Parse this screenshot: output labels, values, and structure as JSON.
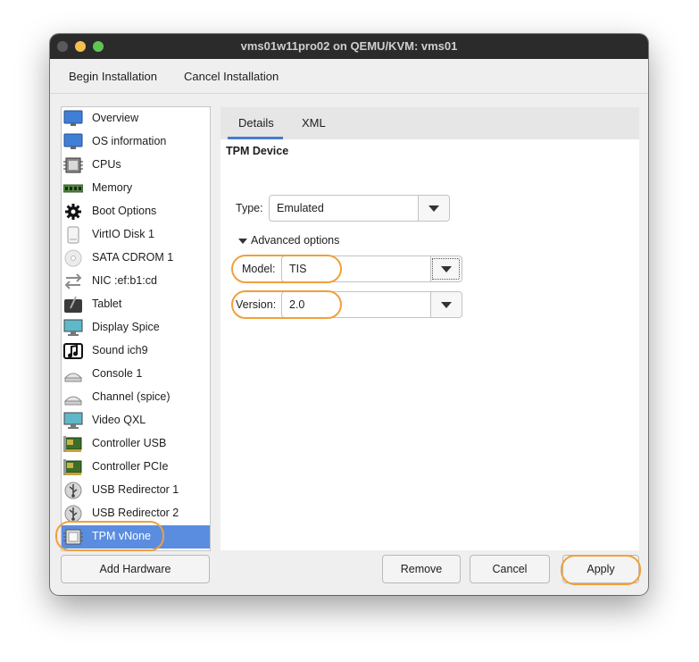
{
  "window": {
    "title": "vms01w11pro02 on QEMU/KVM: vms01"
  },
  "menubar": {
    "begin": "Begin Installation",
    "cancel": "Cancel Installation"
  },
  "sidebar": {
    "items": [
      {
        "label": "Overview",
        "icon": "monitor-icon"
      },
      {
        "label": "OS information",
        "icon": "monitor-icon"
      },
      {
        "label": "CPUs",
        "icon": "cpu-chip-icon"
      },
      {
        "label": "Memory",
        "icon": "memory-module-icon"
      },
      {
        "label": "Boot Options",
        "icon": "gear-icon"
      },
      {
        "label": "VirtIO Disk 1",
        "icon": "disk-icon"
      },
      {
        "label": "SATA CDROM 1",
        "icon": "cdrom-icon"
      },
      {
        "label": "NIC :ef:b1:cd",
        "icon": "network-arrows-icon"
      },
      {
        "label": "Tablet",
        "icon": "tablet-icon"
      },
      {
        "label": "Display Spice",
        "icon": "display-icon"
      },
      {
        "label": "Sound ich9",
        "icon": "sound-icon"
      },
      {
        "label": "Console 1",
        "icon": "serial-port-icon"
      },
      {
        "label": "Channel (spice)",
        "icon": "serial-port-icon"
      },
      {
        "label": "Video QXL",
        "icon": "display-icon"
      },
      {
        "label": "Controller USB",
        "icon": "pci-card-icon"
      },
      {
        "label": "Controller PCIe",
        "icon": "pci-card-icon"
      },
      {
        "label": "USB Redirector 1",
        "icon": "usb-icon"
      },
      {
        "label": "USB Redirector 2",
        "icon": "usb-icon"
      },
      {
        "label": "TPM vNone",
        "icon": "tpm-chip-icon",
        "selected": true
      }
    ],
    "selected_color": "#5a8de0"
  },
  "tabs": {
    "details": "Details",
    "xml": "XML"
  },
  "tpm": {
    "section_title": "TPM Device",
    "type_label": "Type:",
    "type_value": "Emulated",
    "advanced_label": "Advanced options",
    "model_label": "Model:",
    "model_value": "TIS",
    "version_label": "Version:",
    "version_value": "2.0"
  },
  "buttons": {
    "add_hardware": "Add Hardware",
    "remove": "Remove",
    "cancel": "Cancel",
    "apply": "Apply"
  },
  "highlight_color": "#f0a03c"
}
